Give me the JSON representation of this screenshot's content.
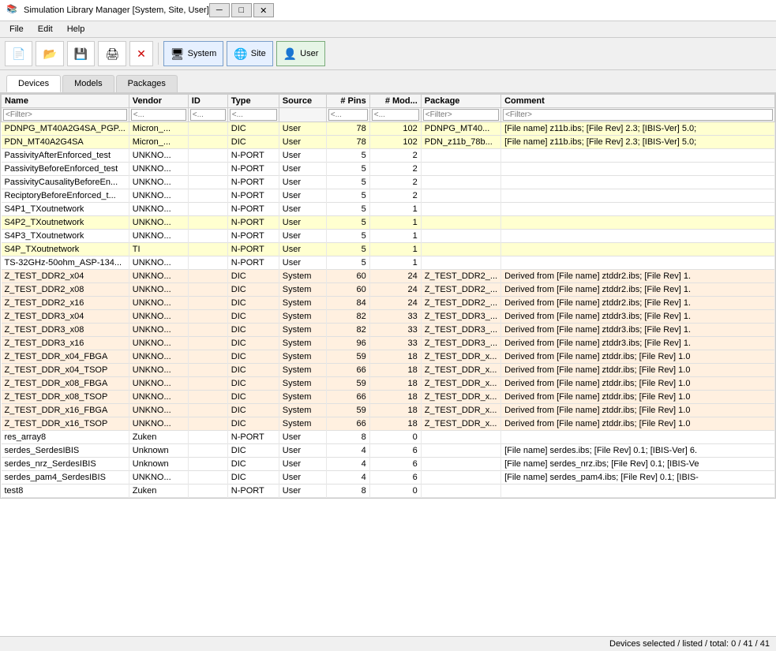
{
  "titleBar": {
    "title": "Simulation Library Manager [System, Site, User]",
    "icon": "📚",
    "minimizeBtn": "─",
    "maximizeBtn": "□",
    "closeBtn": "✕"
  },
  "menuBar": {
    "items": [
      "File",
      "Edit",
      "Help"
    ]
  },
  "toolbar": {
    "buttons": [
      {
        "id": "new",
        "icon": "📄",
        "tooltip": "New"
      },
      {
        "id": "open",
        "icon": "📂",
        "tooltip": "Open"
      },
      {
        "id": "save",
        "icon": "💾",
        "tooltip": "Save"
      },
      {
        "id": "print",
        "icon": "🖨",
        "tooltip": "Print"
      },
      {
        "id": "delete",
        "icon": "✕",
        "tooltip": "Delete"
      },
      {
        "id": "system",
        "label": "System",
        "class": "btn-system"
      },
      {
        "id": "site",
        "label": "Site",
        "class": "btn-site"
      },
      {
        "id": "user",
        "label": "User",
        "class": "btn-user"
      }
    ]
  },
  "tabs": {
    "items": [
      "Devices",
      "Models",
      "Packages"
    ],
    "active": "Devices"
  },
  "table": {
    "columns": [
      {
        "id": "name",
        "label": "Name",
        "filter": "<Filter>"
      },
      {
        "id": "vendor",
        "label": "Vendor",
        "filter": "<..."
      },
      {
        "id": "id",
        "label": "ID",
        "filter": "<..."
      },
      {
        "id": "type",
        "label": "Type",
        "filter": "<..."
      },
      {
        "id": "source",
        "label": "Source",
        "filter": ""
      },
      {
        "id": "pins",
        "label": "# Pins",
        "filter": "<..."
      },
      {
        "id": "models",
        "label": "# Mod...",
        "filter": "<..."
      },
      {
        "id": "package",
        "label": "Package",
        "filter": "<Filter>"
      },
      {
        "id": "comment",
        "label": "Comment",
        "filter": "<Filter>"
      }
    ],
    "rows": [
      {
        "name": "PDNPG_MT40A2G4SA_PGP...",
        "vendor": "Micron_...",
        "id": "",
        "type": "DIC",
        "source": "User",
        "pins": "78",
        "models": "102",
        "package": "PDNPG_MT40...",
        "comment": "[File name] z11b.ibs; [File Rev] 2.3; [IBIS-Ver] 5.0;",
        "rowClass": "row-yellow"
      },
      {
        "name": "PDN_MT40A2G4SA",
        "vendor": "Micron_...",
        "id": "",
        "type": "DIC",
        "source": "User",
        "pins": "78",
        "models": "102",
        "package": "PDN_z11b_78b...",
        "comment": "[File name] z11b.ibs; [File Rev] 2.3; [IBIS-Ver] 5.0;",
        "rowClass": "row-yellow"
      },
      {
        "name": "PassivityAfterEnforced_test",
        "vendor": "UNKNO...",
        "id": "",
        "type": "N-PORT",
        "source": "User",
        "pins": "5",
        "models": "2",
        "package": "",
        "comment": "",
        "rowClass": "row-normal"
      },
      {
        "name": "PassivityBeforeEnforced_test",
        "vendor": "UNKNO...",
        "id": "",
        "type": "N-PORT",
        "source": "User",
        "pins": "5",
        "models": "2",
        "package": "",
        "comment": "",
        "rowClass": "row-normal"
      },
      {
        "name": "PassivityCausalityBeforeEn...",
        "vendor": "UNKNO...",
        "id": "",
        "type": "N-PORT",
        "source": "User",
        "pins": "5",
        "models": "2",
        "package": "",
        "comment": "",
        "rowClass": "row-normal"
      },
      {
        "name": "ReciptoryBeforeEnforced_t...",
        "vendor": "UNKNO...",
        "id": "",
        "type": "N-PORT",
        "source": "User",
        "pins": "5",
        "models": "2",
        "package": "",
        "comment": "",
        "rowClass": "row-normal"
      },
      {
        "name": "S4P1_TXoutnetwork",
        "vendor": "UNKNO...",
        "id": "",
        "type": "N-PORT",
        "source": "User",
        "pins": "5",
        "models": "1",
        "package": "",
        "comment": "",
        "rowClass": "row-normal"
      },
      {
        "name": "S4P2_TXoutnetwork",
        "vendor": "UNKNO...",
        "id": "",
        "type": "N-PORT",
        "source": "User",
        "pins": "5",
        "models": "1",
        "package": "",
        "comment": "",
        "rowClass": "row-yellow"
      },
      {
        "name": "S4P3_TXoutnetwork",
        "vendor": "UNKNO...",
        "id": "",
        "type": "N-PORT",
        "source": "User",
        "pins": "5",
        "models": "1",
        "package": "",
        "comment": "",
        "rowClass": "row-normal"
      },
      {
        "name": "S4P_TXoutnetwork",
        "vendor": "TI",
        "id": "",
        "type": "N-PORT",
        "source": "User",
        "pins": "5",
        "models": "1",
        "package": "",
        "comment": "",
        "rowClass": "row-yellow"
      },
      {
        "name": "TS-32GHz-50ohm_ASP-134...",
        "vendor": "UNKNO...",
        "id": "",
        "type": "N-PORT",
        "source": "User",
        "pins": "5",
        "models": "1",
        "package": "",
        "comment": "",
        "rowClass": "row-normal"
      },
      {
        "name": "Z_TEST_DDR2_x04",
        "vendor": "UNKNO...",
        "id": "",
        "type": "DIC",
        "source": "System",
        "pins": "60",
        "models": "24",
        "package": "Z_TEST_DDR2_...",
        "comment": "Derived from [File name] ztddr2.ibs; [File Rev] 1.",
        "rowClass": "row-system"
      },
      {
        "name": "Z_TEST_DDR2_x08",
        "vendor": "UNKNO...",
        "id": "",
        "type": "DIC",
        "source": "System",
        "pins": "60",
        "models": "24",
        "package": "Z_TEST_DDR2_...",
        "comment": "Derived from [File name] ztddr2.ibs; [File Rev] 1.",
        "rowClass": "row-system"
      },
      {
        "name": "Z_TEST_DDR2_x16",
        "vendor": "UNKNO...",
        "id": "",
        "type": "DIC",
        "source": "System",
        "pins": "84",
        "models": "24",
        "package": "Z_TEST_DDR2_...",
        "comment": "Derived from [File name] ztddr2.ibs; [File Rev] 1.",
        "rowClass": "row-system"
      },
      {
        "name": "Z_TEST_DDR3_x04",
        "vendor": "UNKNO...",
        "id": "",
        "type": "DIC",
        "source": "System",
        "pins": "82",
        "models": "33",
        "package": "Z_TEST_DDR3_...",
        "comment": "Derived from [File name] ztddr3.ibs; [File Rev] 1.",
        "rowClass": "row-system"
      },
      {
        "name": "Z_TEST_DDR3_x08",
        "vendor": "UNKNO...",
        "id": "",
        "type": "DIC",
        "source": "System",
        "pins": "82",
        "models": "33",
        "package": "Z_TEST_DDR3_...",
        "comment": "Derived from [File name] ztddr3.ibs; [File Rev] 1.",
        "rowClass": "row-system"
      },
      {
        "name": "Z_TEST_DDR3_x16",
        "vendor": "UNKNO...",
        "id": "",
        "type": "DIC",
        "source": "System",
        "pins": "96",
        "models": "33",
        "package": "Z_TEST_DDR3_...",
        "comment": "Derived from [File name] ztddr3.ibs; [File Rev] 1.",
        "rowClass": "row-system"
      },
      {
        "name": "Z_TEST_DDR_x04_FBGA",
        "vendor": "UNKNO...",
        "id": "",
        "type": "DIC",
        "source": "System",
        "pins": "59",
        "models": "18",
        "package": "Z_TEST_DDR_x...",
        "comment": "Derived from [File name] ztddr.ibs; [File Rev] 1.0",
        "rowClass": "row-system"
      },
      {
        "name": "Z_TEST_DDR_x04_TSOP",
        "vendor": "UNKNO...",
        "id": "",
        "type": "DIC",
        "source": "System",
        "pins": "66",
        "models": "18",
        "package": "Z_TEST_DDR_x...",
        "comment": "Derived from [File name] ztddr.ibs; [File Rev] 1.0",
        "rowClass": "row-system"
      },
      {
        "name": "Z_TEST_DDR_x08_FBGA",
        "vendor": "UNKNO...",
        "id": "",
        "type": "DIC",
        "source": "System",
        "pins": "59",
        "models": "18",
        "package": "Z_TEST_DDR_x...",
        "comment": "Derived from [File name] ztddr.ibs; [File Rev] 1.0",
        "rowClass": "row-system"
      },
      {
        "name": "Z_TEST_DDR_x08_TSOP",
        "vendor": "UNKNO...",
        "id": "",
        "type": "DIC",
        "source": "System",
        "pins": "66",
        "models": "18",
        "package": "Z_TEST_DDR_x...",
        "comment": "Derived from [File name] ztddr.ibs; [File Rev] 1.0",
        "rowClass": "row-system"
      },
      {
        "name": "Z_TEST_DDR_x16_FBGA",
        "vendor": "UNKNO...",
        "id": "",
        "type": "DIC",
        "source": "System",
        "pins": "59",
        "models": "18",
        "package": "Z_TEST_DDR_x...",
        "comment": "Derived from [File name] ztddr.ibs; [File Rev] 1.0",
        "rowClass": "row-system"
      },
      {
        "name": "Z_TEST_DDR_x16_TSOP",
        "vendor": "UNKNO...",
        "id": "",
        "type": "DIC",
        "source": "System",
        "pins": "66",
        "models": "18",
        "package": "Z_TEST_DDR_x...",
        "comment": "Derived from [File name] ztddr.ibs; [File Rev] 1.0",
        "rowClass": "row-system"
      },
      {
        "name": "res_array8",
        "vendor": "Zuken",
        "id": "",
        "type": "N-PORT",
        "source": "User",
        "pins": "8",
        "models": "0",
        "package": "",
        "comment": "",
        "rowClass": "row-normal"
      },
      {
        "name": "serdes_SerdesIBIS",
        "vendor": "Unknown",
        "id": "",
        "type": "DIC",
        "source": "User",
        "pins": "4",
        "models": "6",
        "package": "",
        "comment": "[File name] serdes.ibs; [File Rev] 0.1; [IBIS-Ver] 6.",
        "rowClass": "row-normal"
      },
      {
        "name": "serdes_nrz_SerdesIBIS",
        "vendor": "Unknown",
        "id": "",
        "type": "DIC",
        "source": "User",
        "pins": "4",
        "models": "6",
        "package": "",
        "comment": "[File name] serdes_nrz.ibs; [File Rev] 0.1; [IBIS-Ve",
        "rowClass": "row-normal"
      },
      {
        "name": "serdes_pam4_SerdesIBIS",
        "vendor": "UNKNO...",
        "id": "",
        "type": "DIC",
        "source": "User",
        "pins": "4",
        "models": "6",
        "package": "",
        "comment": "[File name] serdes_pam4.ibs; [File Rev] 0.1; [IBIS-",
        "rowClass": "row-normal"
      },
      {
        "name": "test8",
        "vendor": "Zuken",
        "id": "",
        "type": "N-PORT",
        "source": "User",
        "pins": "8",
        "models": "0",
        "package": "",
        "comment": "",
        "rowClass": "row-normal"
      }
    ]
  },
  "statusBar": {
    "text": "Devices selected / listed / total:  0 /  41 / 41"
  }
}
